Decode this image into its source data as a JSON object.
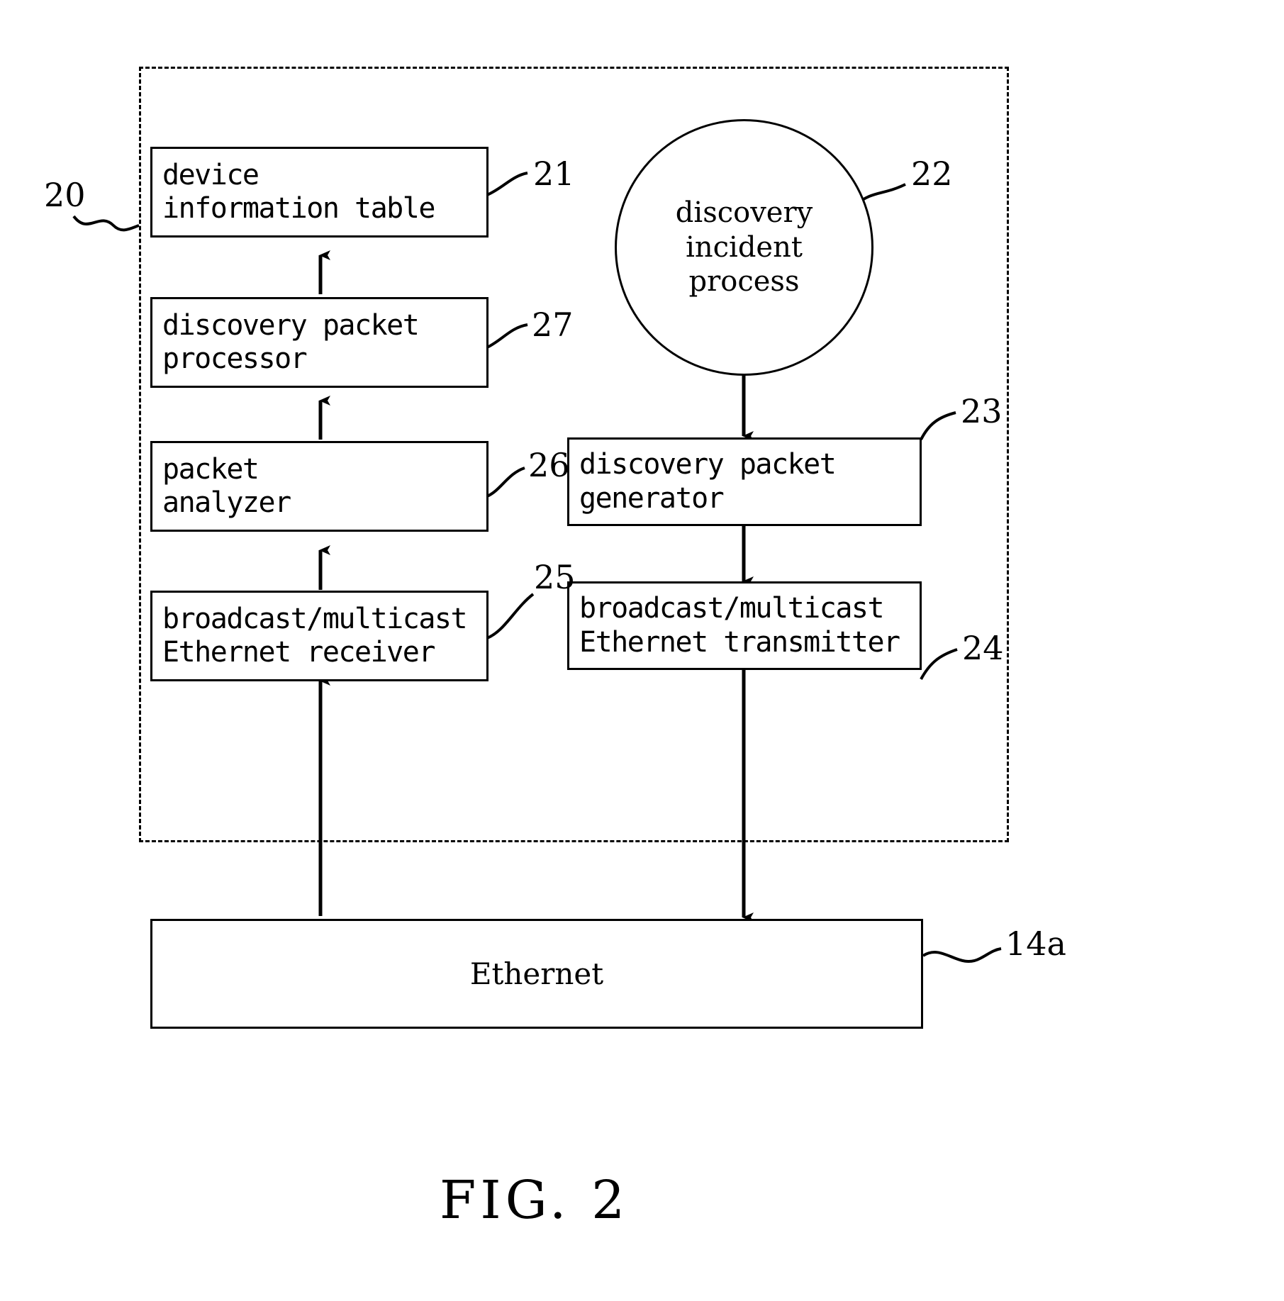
{
  "figure": {
    "caption": "FIG. 2",
    "type": "patent-block-diagram"
  },
  "enclosure": {
    "label": "20",
    "style": "dashed"
  },
  "nodes": [
    {
      "id": "device-information-table",
      "ref": "21",
      "shape": "rect",
      "lines": [
        "device",
        "information table"
      ]
    },
    {
      "id": "discovery-incident-process",
      "ref": "22",
      "shape": "circle",
      "lines": [
        "discovery",
        "incident",
        "process"
      ]
    },
    {
      "id": "discovery-packet-processor",
      "ref": "27",
      "shape": "rect",
      "lines": [
        "discovery packet",
        "processor"
      ]
    },
    {
      "id": "discovery-packet-generator",
      "ref": "23",
      "shape": "rect",
      "lines": [
        "discovery packet",
        "generator"
      ]
    },
    {
      "id": "packet-analyzer",
      "ref": "26",
      "shape": "rect",
      "lines": [
        "packet",
        "analyzer"
      ]
    },
    {
      "id": "broadcast-multicast-ethernet-receiver",
      "ref": "25",
      "shape": "rect",
      "lines": [
        "broadcast/multicast",
        "Ethernet receiver"
      ]
    },
    {
      "id": "broadcast-multicast-ethernet-transmitter",
      "ref": "24",
      "shape": "rect",
      "lines": [
        "broadcast/multicast",
        "Ethernet transmitter"
      ]
    },
    {
      "id": "ethernet",
      "ref": "14a",
      "shape": "rect",
      "lines": [
        "Ethernet"
      ]
    }
  ],
  "refs": {
    "enclosure_20": "20",
    "device_information_table_21": "21",
    "discovery_incident_process_22": "22",
    "discovery_packet_generator_23": "23",
    "ethernet_transmitter_24": "24",
    "ethernet_receiver_25": "25",
    "packet_analyzer_26": "26",
    "discovery_packet_processor_27": "27",
    "ethernet_14a": "14a"
  },
  "box_text": {
    "device_information_table": {
      "l1": "device",
      "l2": "information table"
    },
    "discovery_incident_process": {
      "l1": "discovery",
      "l2": "incident",
      "l3": "process"
    },
    "discovery_packet_processor": {
      "l1": "discovery packet",
      "l2": "processor"
    },
    "discovery_packet_generator": {
      "l1": "discovery packet",
      "l2": "generator"
    },
    "packet_analyzer": {
      "l1": "packet",
      "l2": "analyzer"
    },
    "ethernet_receiver": {
      "l1": "broadcast/multicast",
      "l2": "Ethernet receiver"
    },
    "ethernet_transmitter": {
      "l1": "broadcast/multicast",
      "l2": "Ethernet transmitter"
    },
    "ethernet": {
      "l1": "Ethernet"
    }
  },
  "flows": [
    {
      "from": "discovery-packet-processor",
      "to": "device-information-table",
      "direction": "up"
    },
    {
      "from": "packet-analyzer",
      "to": "discovery-packet-processor",
      "direction": "up"
    },
    {
      "from": "broadcast-multicast-ethernet-receiver",
      "to": "packet-analyzer",
      "direction": "up"
    },
    {
      "from": "ethernet",
      "to": "broadcast-multicast-ethernet-receiver",
      "direction": "up"
    },
    {
      "from": "discovery-incident-process",
      "to": "discovery-packet-generator",
      "direction": "down"
    },
    {
      "from": "discovery-packet-generator",
      "to": "broadcast-multicast-ethernet-transmitter",
      "direction": "down"
    },
    {
      "from": "broadcast-multicast-ethernet-transmitter",
      "to": "ethernet",
      "direction": "down"
    }
  ],
  "colors": {
    "ink": "#000000",
    "paper": "#ffffff"
  }
}
